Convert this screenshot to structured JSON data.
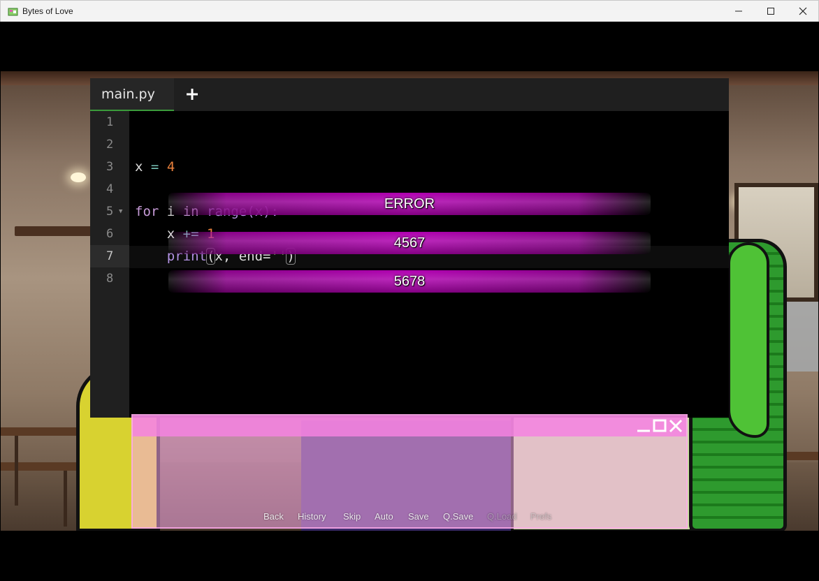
{
  "window": {
    "title": "Bytes of Love"
  },
  "editor": {
    "tab_label": "main.py",
    "add_tab_symbol": "+",
    "line_numbers": [
      "1",
      "2",
      "3",
      "4",
      "5",
      "6",
      "7",
      "8"
    ],
    "code": {
      "line3": {
        "var": "x",
        "op": "=",
        "num": "4"
      },
      "line5": {
        "kw1": "for",
        "var": "i",
        "kw2": "in",
        "fn": "range",
        "rest": "(x):"
      },
      "line6": {
        "var": "x",
        "op": "+=",
        "num": "1"
      },
      "line7": {
        "fn": "print",
        "open": "(",
        "args": "x, end=",
        "str": "''",
        "close": ")"
      }
    }
  },
  "choices": [
    "ERROR",
    "4567",
    "5678"
  ],
  "quick_menu": {
    "items": [
      "Back",
      "History",
      "Skip",
      "Auto",
      "Save",
      "Q.Save",
      "Q.Load",
      "Prefs"
    ],
    "disabled": [
      "Q.Load"
    ]
  },
  "colors": {
    "choice_accent": "#b000b0",
    "textbox_pink": "#f582e1",
    "editor_tab_underline": "#3b9b3b"
  }
}
